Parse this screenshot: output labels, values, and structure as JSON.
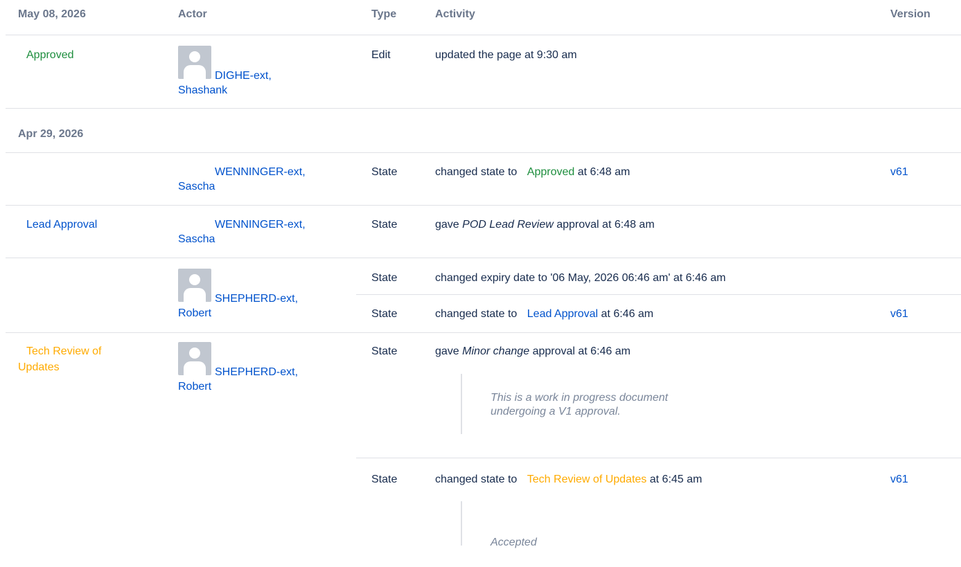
{
  "headers": {
    "date1": "May 08, 2026",
    "actor": "Actor",
    "type": "Type",
    "activity": "Activity",
    "version": "Version"
  },
  "group2_date": "Apr 29, 2026",
  "rows": [
    {
      "status": "Approved",
      "actor_line1": "DIGHE-ext,",
      "actor_line2": "Shashank",
      "type": "Edit",
      "activity": "updated the page at 9:30 am"
    },
    {
      "actor_line1": "WENNINGER-ext,",
      "actor_line2": "Sascha",
      "type": "State",
      "activity_pre": "changed state to",
      "state": "Approved",
      "activity_post": "at 6:48 am",
      "version": "v61"
    },
    {
      "status": "Lead Approval",
      "actor_line1": "WENNINGER-ext,",
      "actor_line2": "Sascha",
      "type": "State",
      "activity_pre": "gave",
      "approval": "POD Lead Review",
      "activity_post": "approval at 6:48 am"
    },
    {
      "actor_line1": "SHEPHERD-ext,",
      "actor_line2": "Robert",
      "sub": [
        {
          "type": "State",
          "activity": "changed expiry date to '06 May, 2026 06:46 am' at 6:46 am"
        },
        {
          "type": "State",
          "activity_pre": "changed state to",
          "state": "Lead Approval",
          "activity_post": "at 6:46 am",
          "version": "v61"
        }
      ]
    },
    {
      "status_line1": "Tech Review of",
      "status_line2": "Updates",
      "actor_line1": "SHEPHERD-ext,",
      "actor_line2": "Robert",
      "sub": [
        {
          "type": "State",
          "activity_pre": "gave",
          "approval": "Minor change",
          "activity_post": "approval at 6:46 am",
          "comment_line1": "This is a work in progress document",
          "comment_line2": "undergoing a V1 approval."
        },
        {
          "type": "State",
          "activity_pre": "changed state to",
          "state": "Tech Review of Updates",
          "activity_post": "at 6:45 am",
          "version": "v61",
          "comment": "Accepted"
        }
      ]
    }
  ],
  "colors": {
    "approved": "#1e8e3e",
    "lead_approval": "#0052cc",
    "tech_review": "#ffab00",
    "link": "#0052cc",
    "header_text": "#6b778c",
    "divider": "#dfe1e6"
  },
  "icons": [
    "avatar-placeholder-icon"
  ]
}
